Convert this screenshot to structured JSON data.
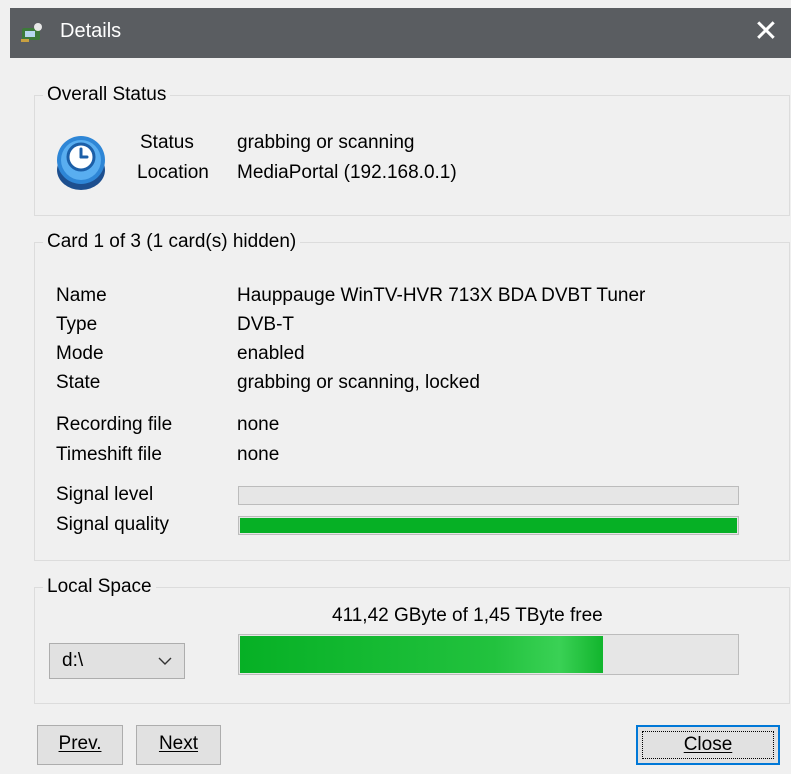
{
  "window": {
    "title": "Details",
    "close_glyph": "✕"
  },
  "overall_status": {
    "legend": "Overall Status",
    "icon": "clock-icon",
    "status_label": "Status",
    "status_value": "grabbing or scanning",
    "location_label": "Location",
    "location_value": "MediaPortal (192.168.0.1)"
  },
  "card": {
    "legend": "Card 1 of 3 (1 card(s) hidden)",
    "name_label": "Name",
    "name_value": "Hauppauge WinTV-HVR 713X BDA DVBT Tuner",
    "type_label": "Type",
    "type_value": "DVB-T",
    "mode_label": "Mode",
    "mode_value": "enabled",
    "state_label": "State",
    "state_value": "grabbing or scanning, locked",
    "recording_label": "Recording file",
    "recording_value": "none",
    "timeshift_label": "Timeshift file",
    "timeshift_value": "none",
    "signal_level_label": "Signal level",
    "signal_level_percent": 0,
    "signal_quality_label": "Signal quality",
    "signal_quality_percent": 100
  },
  "local_space": {
    "legend": "Local Space",
    "drive_selected": "d:\\",
    "free_text": "411,42 GByte of 1,45 TByte free",
    "used_percent": 73
  },
  "buttons": {
    "prev": "Prev.",
    "next": "Next",
    "close": "Close"
  },
  "colors": {
    "progress_green": "#06b025",
    "titlebar": "#5a5d61",
    "default_button_border": "#0078d7"
  }
}
